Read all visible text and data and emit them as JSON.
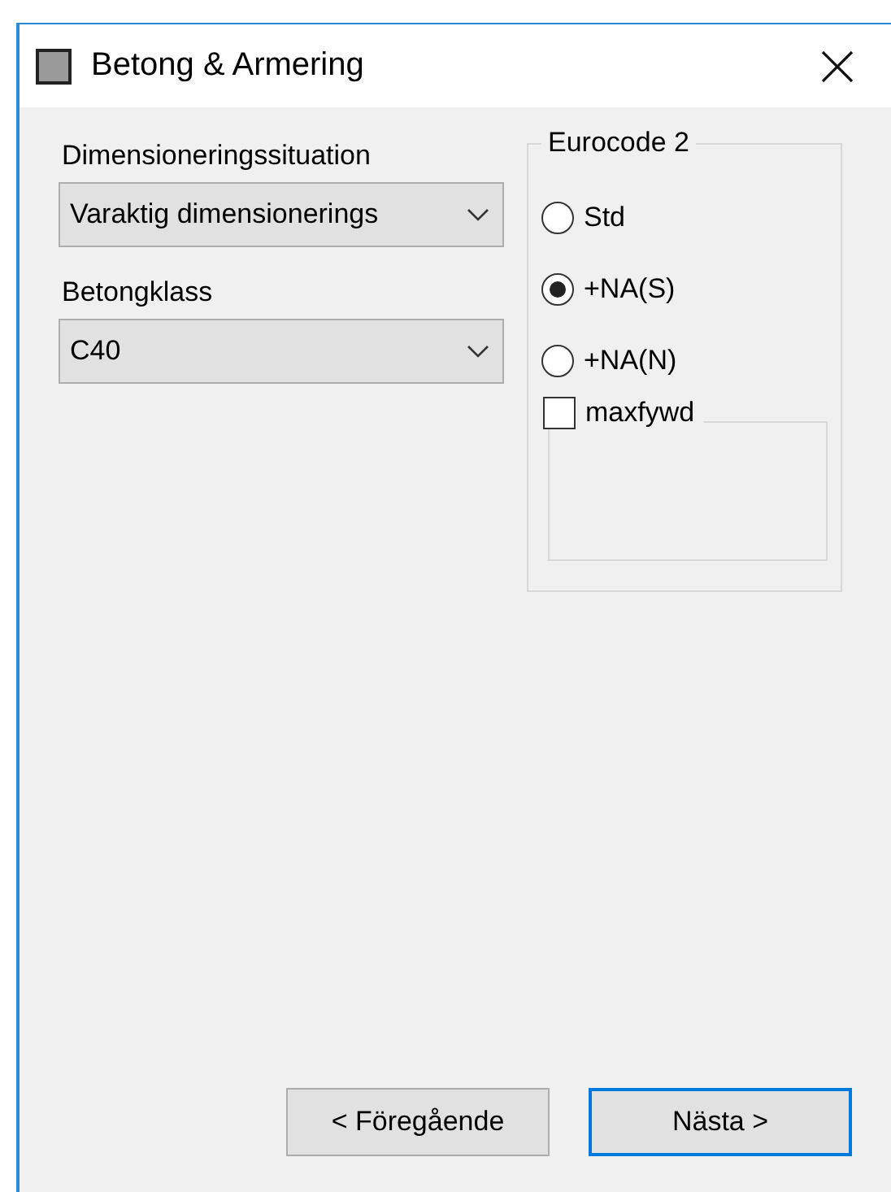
{
  "window": {
    "title": "Betong & Armering"
  },
  "fields": [
    {
      "label": "Dimensioneringssituation",
      "value": "Varaktig dimensionerings"
    },
    {
      "label": "Betongklass",
      "value": "C40"
    }
  ],
  "group": {
    "title": "Eurocode 2",
    "options": [
      {
        "label": "Std",
        "selected": false
      },
      {
        "label": "+NA(S)",
        "selected": true
      },
      {
        "label": "+NA(N)",
        "selected": false
      }
    ],
    "checkbox": {
      "label": "maxfywd",
      "checked": false
    }
  },
  "buttons": [
    {
      "label": "< Föregående",
      "focused": false
    },
    {
      "label": "Nästa >",
      "focused": true
    }
  ]
}
